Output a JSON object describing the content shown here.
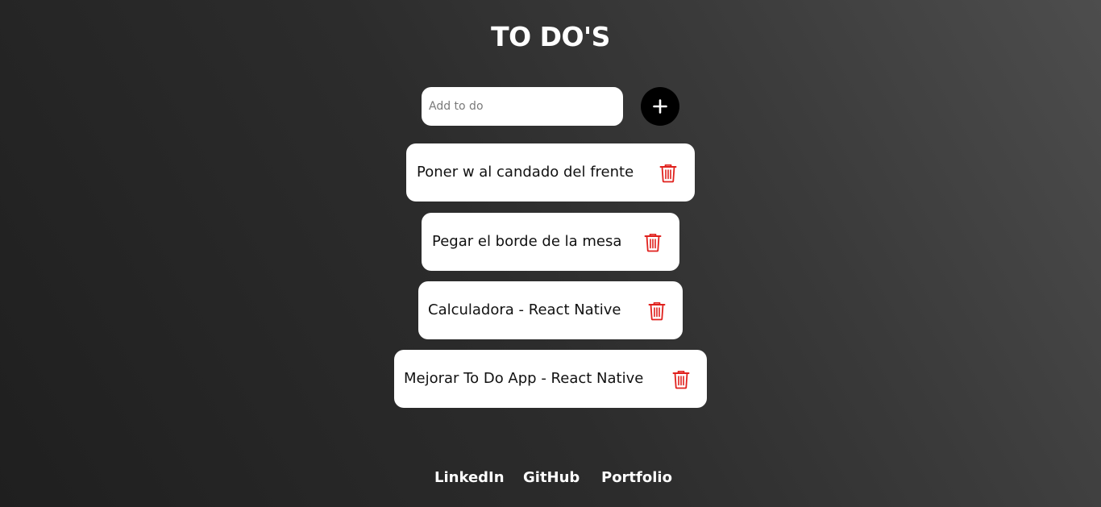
{
  "header": {
    "title": "TO DO'S"
  },
  "form": {
    "input_placeholder": "Add to do",
    "input_value": "",
    "add_button_icon": "plus-icon"
  },
  "todos": [
    {
      "text": "Poner w al candado del frente",
      "delete_icon": "trash-icon"
    },
    {
      "text": "Pegar el borde de la mesa",
      "delete_icon": "trash-icon"
    },
    {
      "text": "Calculadora - React Native",
      "delete_icon": "trash-icon"
    },
    {
      "text": "Mejorar To Do App - React Native",
      "delete_icon": "trash-icon"
    }
  ],
  "footer": {
    "links": [
      "LinkedIn",
      "GitHub",
      "Portfolio"
    ]
  },
  "colors": {
    "background_dark": "#1f1f1f",
    "background_light": "#4d4d4d",
    "card": "#ffffff",
    "add_button": "#000000",
    "delete_icon": "#e0201c"
  }
}
